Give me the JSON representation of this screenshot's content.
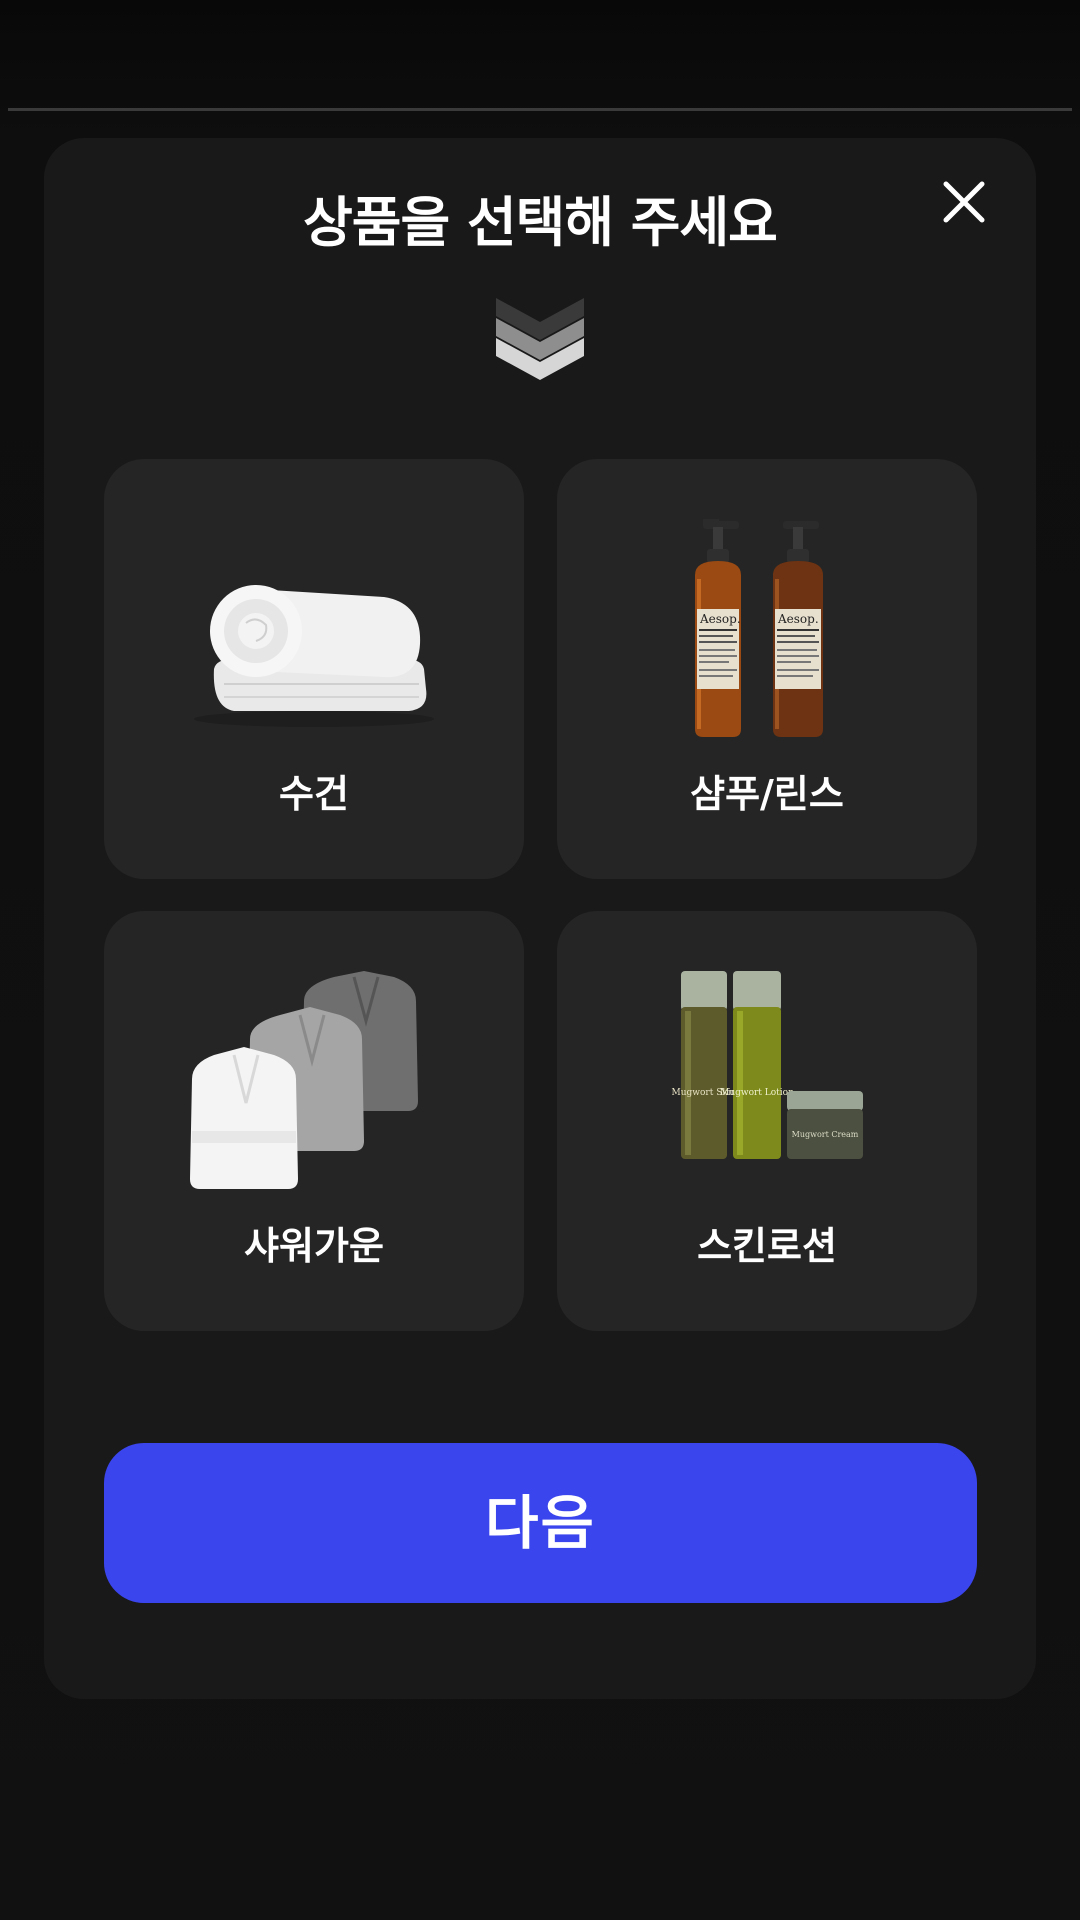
{
  "modal": {
    "title": "상품을 선택해 주세요",
    "close_icon": "close-icon",
    "indicator_icon": "chevron-down-double-icon"
  },
  "products": [
    {
      "label": "수건",
      "icon": "towel-icon"
    },
    {
      "label": "샴푸/린스",
      "icon": "shampoo-bottles-icon",
      "brand_text": "Aesop."
    },
    {
      "label": "샤워가운",
      "icon": "bathrobe-icon"
    },
    {
      "label": "스킨로션",
      "icon": "skincare-set-icon",
      "brand_text": [
        "Mugwort Skin",
        "Mugwort Lotion",
        "Mugwort Cream"
      ]
    }
  ],
  "footer": {
    "next_label": "다음"
  },
  "colors": {
    "background": "#0b0b0b",
    "modal": "#191919",
    "card": "#252525",
    "accent": "#3b45ee",
    "text": "#ffffff"
  }
}
